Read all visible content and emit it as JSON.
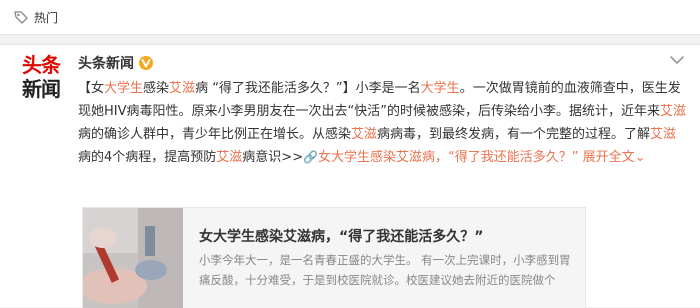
{
  "hot_bar": {
    "label": "热门"
  },
  "account": {
    "logo_line1": "头条",
    "logo_line2": "新闻",
    "name": "头条新闻"
  },
  "post": {
    "segments": [
      {
        "t": "【女",
        "h": false
      },
      {
        "t": "大学生",
        "h": true
      },
      {
        "t": "感染",
        "h": false
      },
      {
        "t": "艾滋",
        "h": true
      },
      {
        "t": "病 “得了我还能活多久？”】小李是一名",
        "h": false
      },
      {
        "t": "大学生",
        "h": true
      },
      {
        "t": "。一次做胃镜前的血液筛查中，医生发现她HIV病毒阳性。原来小李男朋友在一次出去“快活”的时候被感染，后传染给小李。据统计，近年来",
        "h": false
      },
      {
        "t": "艾滋",
        "h": true
      },
      {
        "t": "病的确诊人群中，青少年比例正在增长。从感染",
        "h": false
      },
      {
        "t": "艾滋",
        "h": true
      },
      {
        "t": "病病毒，到最终发病，有一个完整的过程。了解",
        "h": false
      },
      {
        "t": "艾滋",
        "h": true
      },
      {
        "t": "病的4个病程，提高预防",
        "h": false
      },
      {
        "t": "艾滋",
        "h": true
      },
      {
        "t": "病意识>>",
        "h": false
      }
    ],
    "link_icon": "🔗",
    "link_text": "女大学生感染艾滋病，“得了我还能活多久？”",
    "expand_label": "展开全文",
    "expand_arrow": "⌄"
  },
  "preview": {
    "title": "女大学生感染艾滋病，“得了我还能活多久？”",
    "desc": "小李今年大一，是一名青春正盛的大学生。 有一次上完课时，小李感到胃痛反酸，十分难受，于是到校医院就诊。校医建议她去附近的医院做个"
  },
  "colors": {
    "accent": "#eb7350",
    "logo_red": "#e10602",
    "verified": "#f7a91d"
  },
  "icons": {
    "hot": "tag-icon",
    "verified": "verified-badge-icon",
    "more": "chevron-down-icon",
    "link": "link-icon"
  }
}
